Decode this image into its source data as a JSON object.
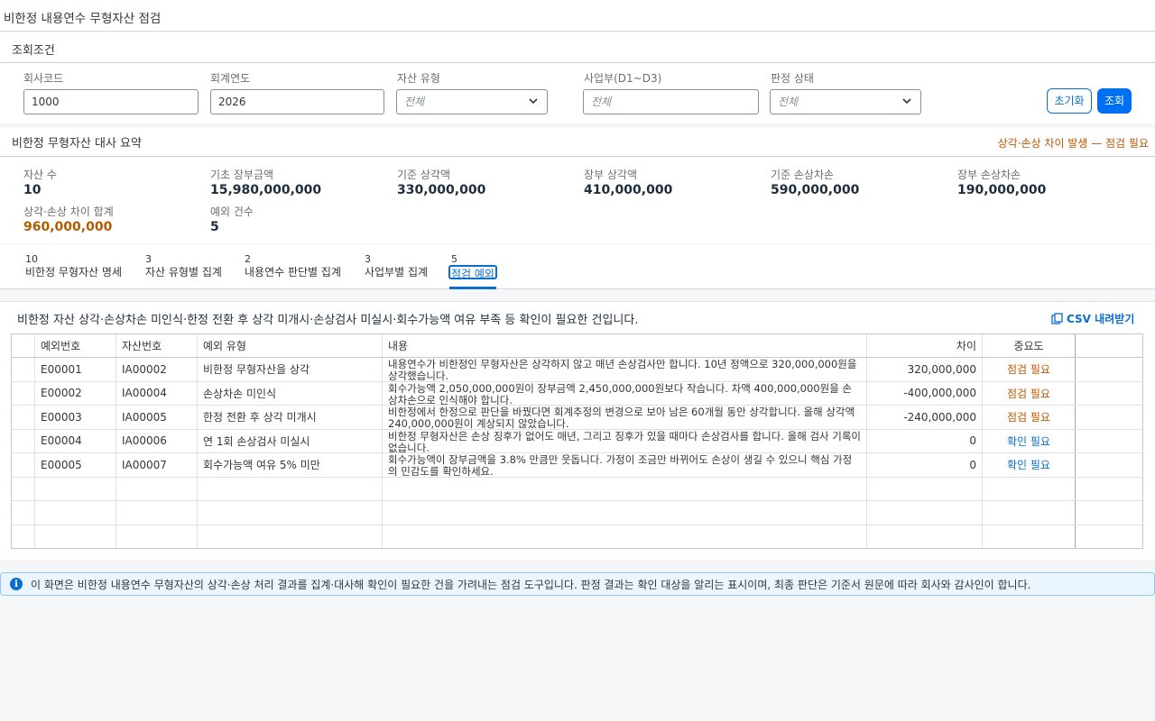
{
  "page": {
    "title": "비한정 내용연수 무형자산 점검"
  },
  "filter": {
    "title": "조회조건",
    "company_label": "회사코드",
    "company_value": "1000",
    "year_label": "회계연도",
    "year_value": "2026",
    "asset_type_label": "자산 유형",
    "asset_type_value": "전체",
    "division_label": "사업부(D1~D3)",
    "division_placeholder": "전체",
    "status_label": "판정 상태",
    "status_value": "전체",
    "reset_label": "초기화",
    "search_label": "조회"
  },
  "summary": {
    "title": "비한정 무형자산 대사 요약",
    "alert": "상각·손상 차이 발생 — 점검 필요",
    "kpis": [
      {
        "label": "자산 수",
        "value": "10"
      },
      {
        "label": "기초 장부금액",
        "value": "15,980,000,000"
      },
      {
        "label": "기준 상각액",
        "value": "330,000,000"
      },
      {
        "label": "장부 상각액",
        "value": "410,000,000"
      },
      {
        "label": "기준 손상차손",
        "value": "590,000,000"
      },
      {
        "label": "장부 손상차손",
        "value": "190,000,000"
      },
      {
        "label": "상각·손상 차이 합계",
        "value": "960,000,000"
      },
      {
        "label": "예외 건수",
        "value": "5"
      }
    ]
  },
  "tabs": [
    {
      "count": "10",
      "label": "비한정 무형자산 명세"
    },
    {
      "count": "3",
      "label": "자산 유형별 집계"
    },
    {
      "count": "2",
      "label": "내용연수 판단별 집계"
    },
    {
      "count": "3",
      "label": "사업부별 집계"
    },
    {
      "count": "5",
      "label": "점검 예외"
    }
  ],
  "panel": {
    "description": "비한정 자산 상각·손상차손 미인식·한정 전환 후 상각 미개시·손상검사 미실시·회수가능액 여유 부족 등 확인이 필요한 건입니다.",
    "csv_label": "CSV 내려받기"
  },
  "table": {
    "columns": [
      "예외번호",
      "자산번호",
      "예외 유형",
      "내용",
      "차이",
      "중요도"
    ],
    "rows": [
      {
        "id": "E00001",
        "asset": "IA00002",
        "type": "비한정 무형자산을 상각",
        "content": "내용연수가 비한정인 무형자산은 상각하지 않고 매년 손상검사만 합니다. 10년 정액으로 320,000,000원을 상각했습니다.",
        "diff": "320,000,000",
        "severity": "점검 필요"
      },
      {
        "id": "E00002",
        "asset": "IA00004",
        "type": "손상차손 미인식",
        "content": "회수가능액 2,050,000,000원이 장부금액 2,450,000,000원보다 작습니다. 차액 400,000,000원을 손상차손으로 인식해야 합니다.",
        "diff": "-400,000,000",
        "severity": "점검 필요"
      },
      {
        "id": "E00003",
        "asset": "IA00005",
        "type": "한정 전환 후 상각 미개시",
        "content": "비한정에서 한정으로 판단을 바꿨다면 회계추정의 변경으로 보아 남은 60개월 동안 상각합니다. 올해 상각액 240,000,000원이 계상되지 않았습니다.",
        "diff": "-240,000,000",
        "severity": "점검 필요"
      },
      {
        "id": "E00004",
        "asset": "IA00006",
        "type": "연 1회 손상검사 미실시",
        "content": "비한정 무형자산은 손상 징후가 없어도 매년, 그리고 징후가 있을 때마다 손상검사를 합니다. 올해 검사 기록이 없습니다.",
        "diff": "0",
        "severity": "확인 필요"
      },
      {
        "id": "E00005",
        "asset": "IA00007",
        "type": "회수가능액 여유 5% 미만",
        "content": "회수가능액이 장부금액을 3.8% 만큼만 웃돕니다. 가정이 조금만 바뀌어도 손상이 생길 수 있으니 핵심 가정의 민감도를 확인하세요.",
        "diff": "0",
        "severity": "확인 필요"
      }
    ]
  },
  "info": {
    "text": "이 화면은 비한정 내용연수 무형자산의 상각·손상 처리 결과를 집계·대사해 확인이 필요한 건을 가려내는 점검 도구입니다. 판정 결과는 확인 대상을 알리는 표시이며, 최종 판단은 기준서 원문에 따라 회사와 감사인이 합니다."
  },
  "colors": {
    "accent": "#0a6ed1",
    "warning": "#c35500",
    "button": "#0070f2"
  },
  "icons": {
    "dropdown": "chevron-down-icon",
    "csv": "csv-download-icon",
    "info": "info-icon"
  }
}
